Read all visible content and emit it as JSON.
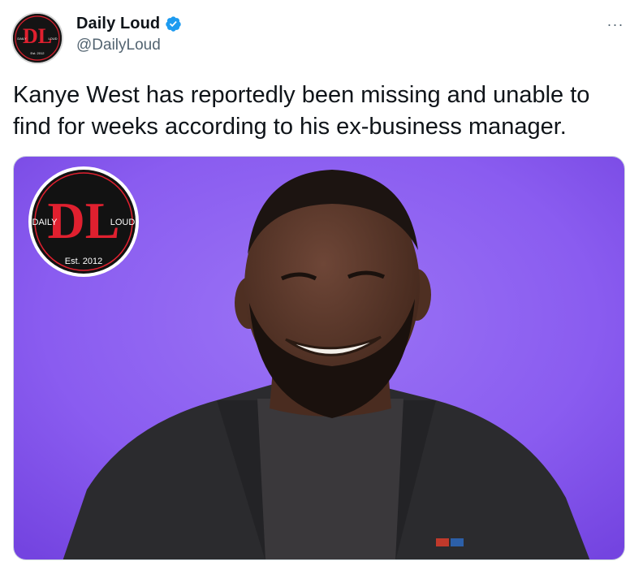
{
  "account": {
    "display_name": "Daily Loud",
    "handle": "@DailyLoud",
    "verified": true,
    "avatar_icon": "daily-loud-logo-icon"
  },
  "menu": {
    "label": "···"
  },
  "tweet": {
    "text": "Kanye West has reportedly been missing  and unable to find for weeks according to his ex-business manager."
  },
  "media": {
    "background_color": "#8a5cf0",
    "logo": {
      "left": "DAILY",
      "right": "LOUD",
      "est": "Est. 2012",
      "letters": "DL"
    }
  },
  "colors": {
    "verified": "#1d9bf0",
    "logo_red": "#e0202f",
    "secondary_text": "#536471"
  }
}
